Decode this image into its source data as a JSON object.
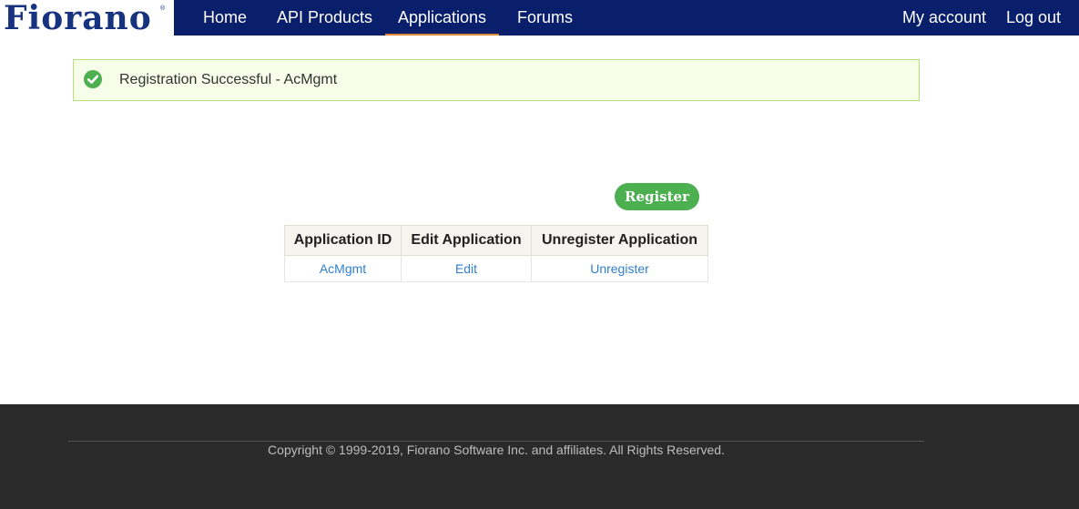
{
  "brand": {
    "logo_text": "Fiorano",
    "logo_mark": "®"
  },
  "nav": {
    "items": [
      {
        "label": "Home"
      },
      {
        "label": "API Products"
      },
      {
        "label": "Applications",
        "active": true
      },
      {
        "label": "Forums"
      }
    ],
    "right": [
      {
        "label": "My account"
      },
      {
        "label": "Log out"
      }
    ]
  },
  "alert": {
    "icon": "check-circle-icon",
    "message": "Registration Successful - AcMgmt",
    "color": "#4caf50"
  },
  "register_button": {
    "label": "Register",
    "color": "#4caf50"
  },
  "table": {
    "headers": [
      "Application ID",
      "Edit Application",
      "Unregister Application"
    ],
    "rows": [
      [
        "AcMgmt",
        "Edit",
        "Unregister"
      ]
    ]
  },
  "footer": {
    "copyright": "Copyright © 1999-2019, Fiorano Software Inc. and affiliates. All Rights Reserved."
  }
}
